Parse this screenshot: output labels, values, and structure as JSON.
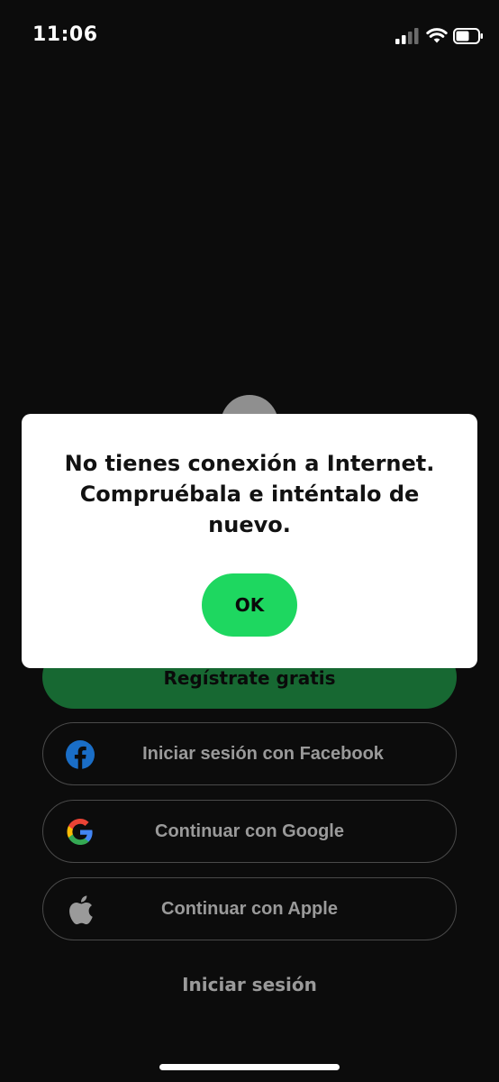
{
  "status_bar": {
    "time": "11:06"
  },
  "background": {
    "signup_label": "Regístrate gratis",
    "social_buttons": [
      {
        "label": "Iniciar sesión con Facebook",
        "icon": "facebook-icon",
        "color": "#1877f2"
      },
      {
        "label": "Continuar con Google",
        "icon": "google-icon"
      },
      {
        "label": "Continuar con Apple",
        "icon": "apple-icon"
      }
    ],
    "login_label": "Iniciar sesión"
  },
  "alert": {
    "message": "No tienes conexión a Internet. Compruébala e inténtalo de nuevo.",
    "ok_label": "OK"
  },
  "colors": {
    "background": "#0c0c0c",
    "accent_green": "#1ed760",
    "dimmed_green": "#176832",
    "dialog_bg": "#ffffff"
  }
}
